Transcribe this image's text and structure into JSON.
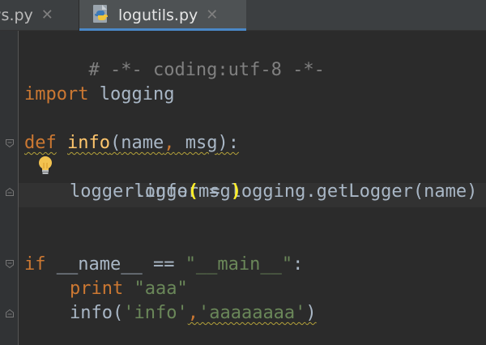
{
  "tabs": [
    {
      "label": "ws.py",
      "close": "✕",
      "active": false
    },
    {
      "label": "logutils.py",
      "close": "✕",
      "active": true
    }
  ],
  "code": {
    "line1": "# -*- coding:utf-8 -*-",
    "line2_kw": "import",
    "line2_mod": " logging",
    "line3_kw": "def",
    "line3_fn": "info",
    "line3_open": "(",
    "line3_param1": "name",
    "line3_comma": ",",
    "line3_param2": " msg",
    "line3_close": "):",
    "line4": "logger = logging.getLogger(name)",
    "line5_a": "logger.info",
    "line5_open": "(",
    "line5_arg": "msg",
    "line5_close": ")",
    "line6_kw": "if",
    "line6_a": " __name__ == ",
    "line6_str": "\"__main__\"",
    "line6_colon": ":",
    "line7_kw": "print",
    "line7_str": " \"aaa\"",
    "line8_a": "info(",
    "line8_str1": "'info'",
    "line8_comma": ",",
    "line8_str2": "'aaaaaaaa'",
    "line8_close": ")"
  },
  "colors": {
    "background": "#2b2b2b",
    "keyword": "#cc7832",
    "comment": "#808080",
    "function": "#ffc66d",
    "string": "#6a8759",
    "text": "#a9b7c6",
    "bracket_match": "#ffef28"
  },
  "icons": {
    "tab_file_icon": "python-icon",
    "gutter_hint": "lightbulb-icon",
    "fold_marker": "fold-icon"
  }
}
